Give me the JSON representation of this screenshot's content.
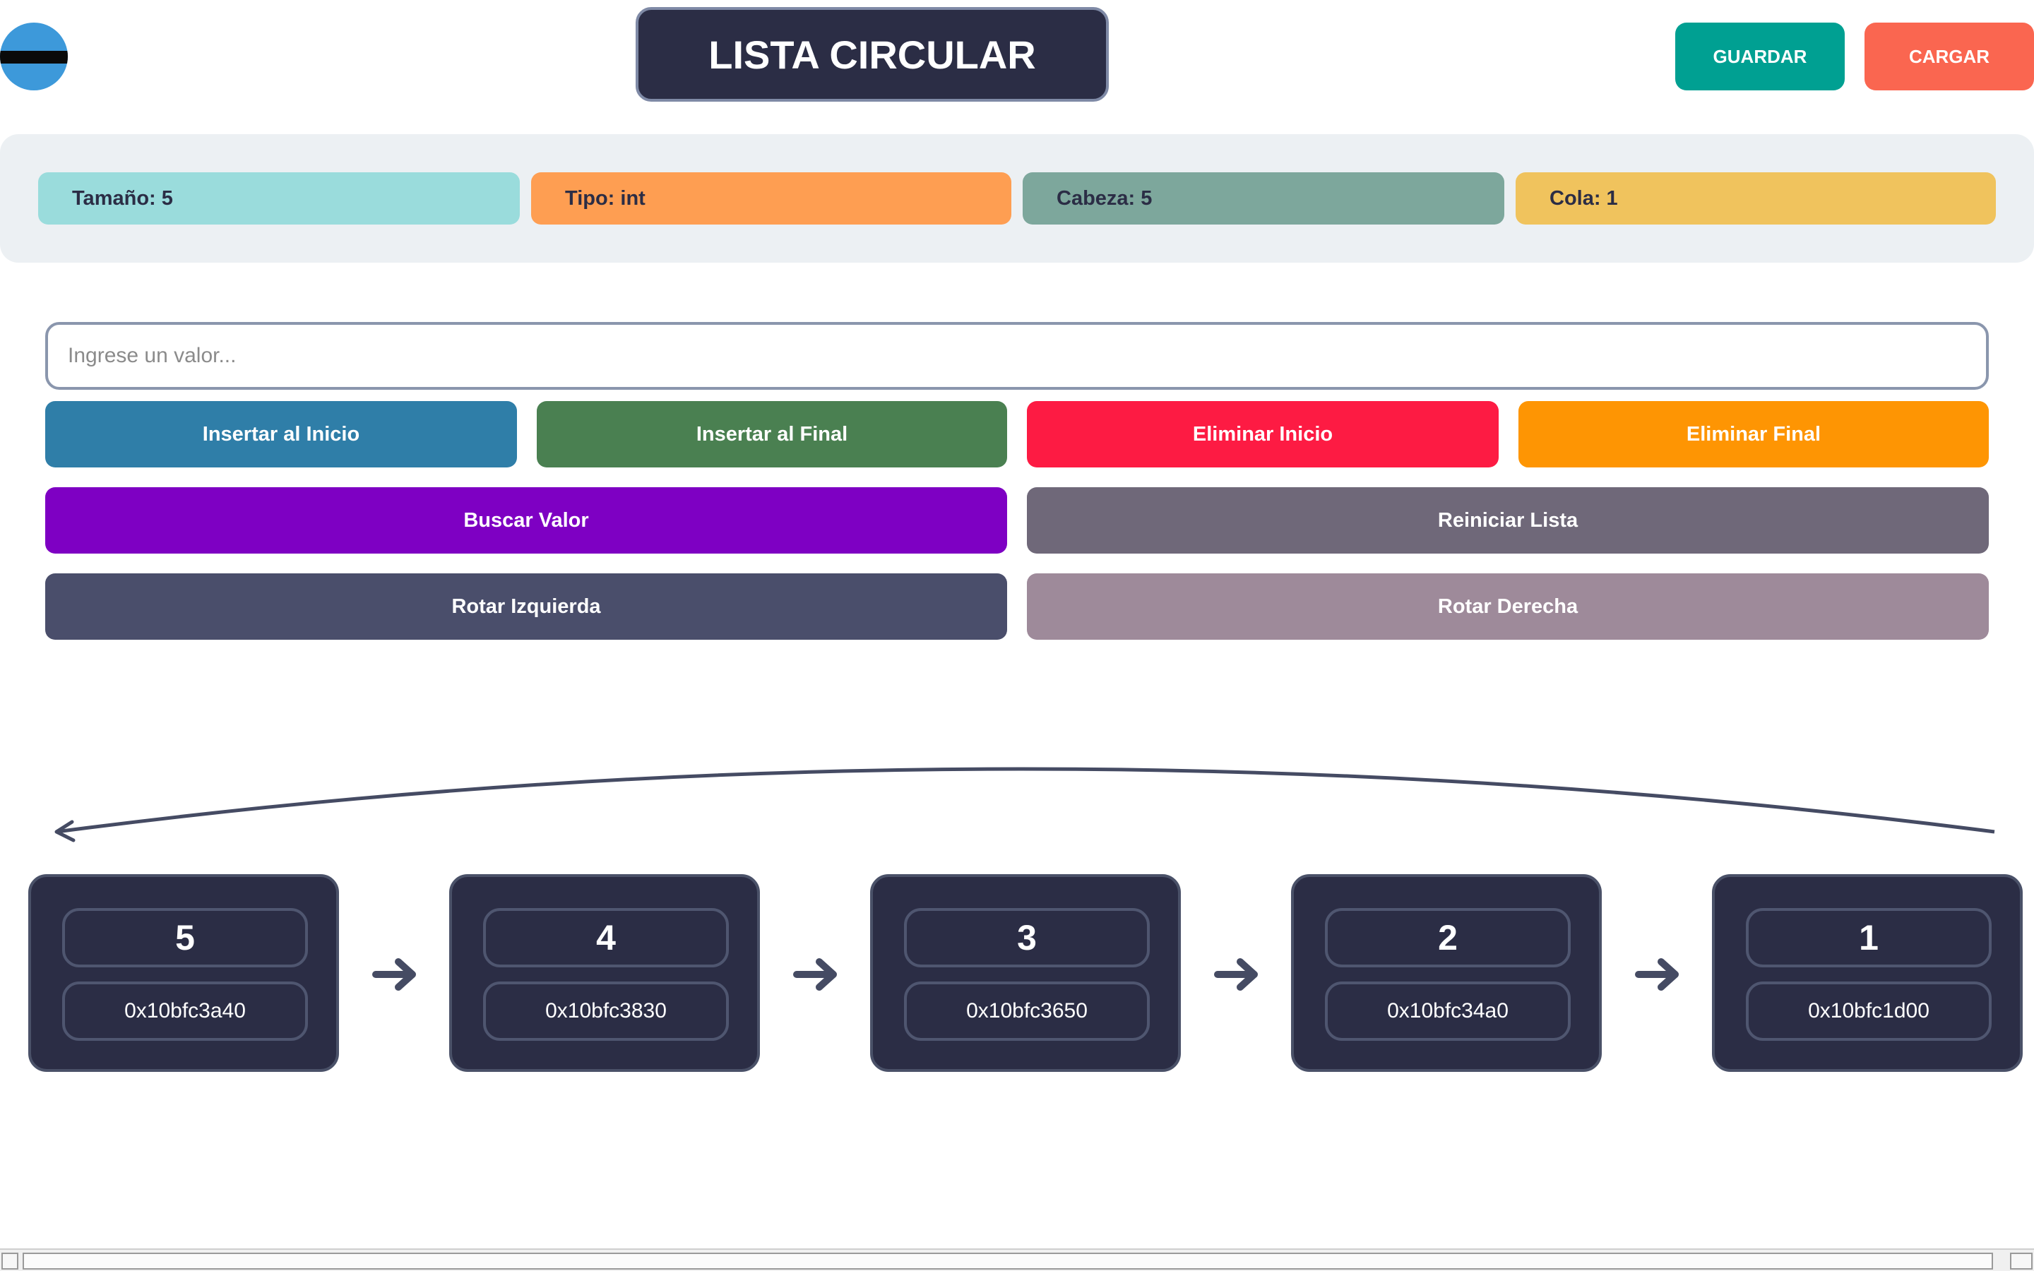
{
  "header": {
    "menu_icon": "hamburger-menu-icon",
    "title": "LISTA CIRCULAR",
    "save_label": "GUARDAR",
    "load_label": "CARGAR"
  },
  "stats": [
    {
      "label": "Tamaño: 5",
      "color": "#9adcdc"
    },
    {
      "label": "Tipo: int",
      "color": "#fe9e52"
    },
    {
      "label": "Cabeza: 5",
      "color": "#7da79c"
    },
    {
      "label": "Cola: 1",
      "color": "#f0c35d"
    }
  ],
  "input": {
    "placeholder": "Ingrese un valor...",
    "value": ""
  },
  "actions": {
    "insert_start": "Insertar al Inicio",
    "insert_end": "Insertar al Final",
    "delete_start": "Eliminar Inicio",
    "delete_end": "Eliminar Final",
    "search": "Buscar Valor",
    "reset": "Reiniciar Lista",
    "rotate_left": "Rotar Izquierda",
    "rotate_right": "Rotar Derecha"
  },
  "colors": {
    "insert_start": "#2f7ea8",
    "insert_end": "#4a8051",
    "delete_start": "#fd1b43",
    "delete_end": "#fe9503",
    "search": "#7e00c3",
    "reset": "#6f6879",
    "rotate_left": "#4a4e6b",
    "rotate_right": "#9e8a9a"
  },
  "nodes": [
    {
      "value": "5",
      "address": "0x10bfc3a40"
    },
    {
      "value": "4",
      "address": "0x10bfc3830"
    },
    {
      "value": "3",
      "address": "0x10bfc3650"
    },
    {
      "value": "2",
      "address": "0x10bfc34a0"
    },
    {
      "value": "1",
      "address": "0x10bfc1d00"
    }
  ]
}
